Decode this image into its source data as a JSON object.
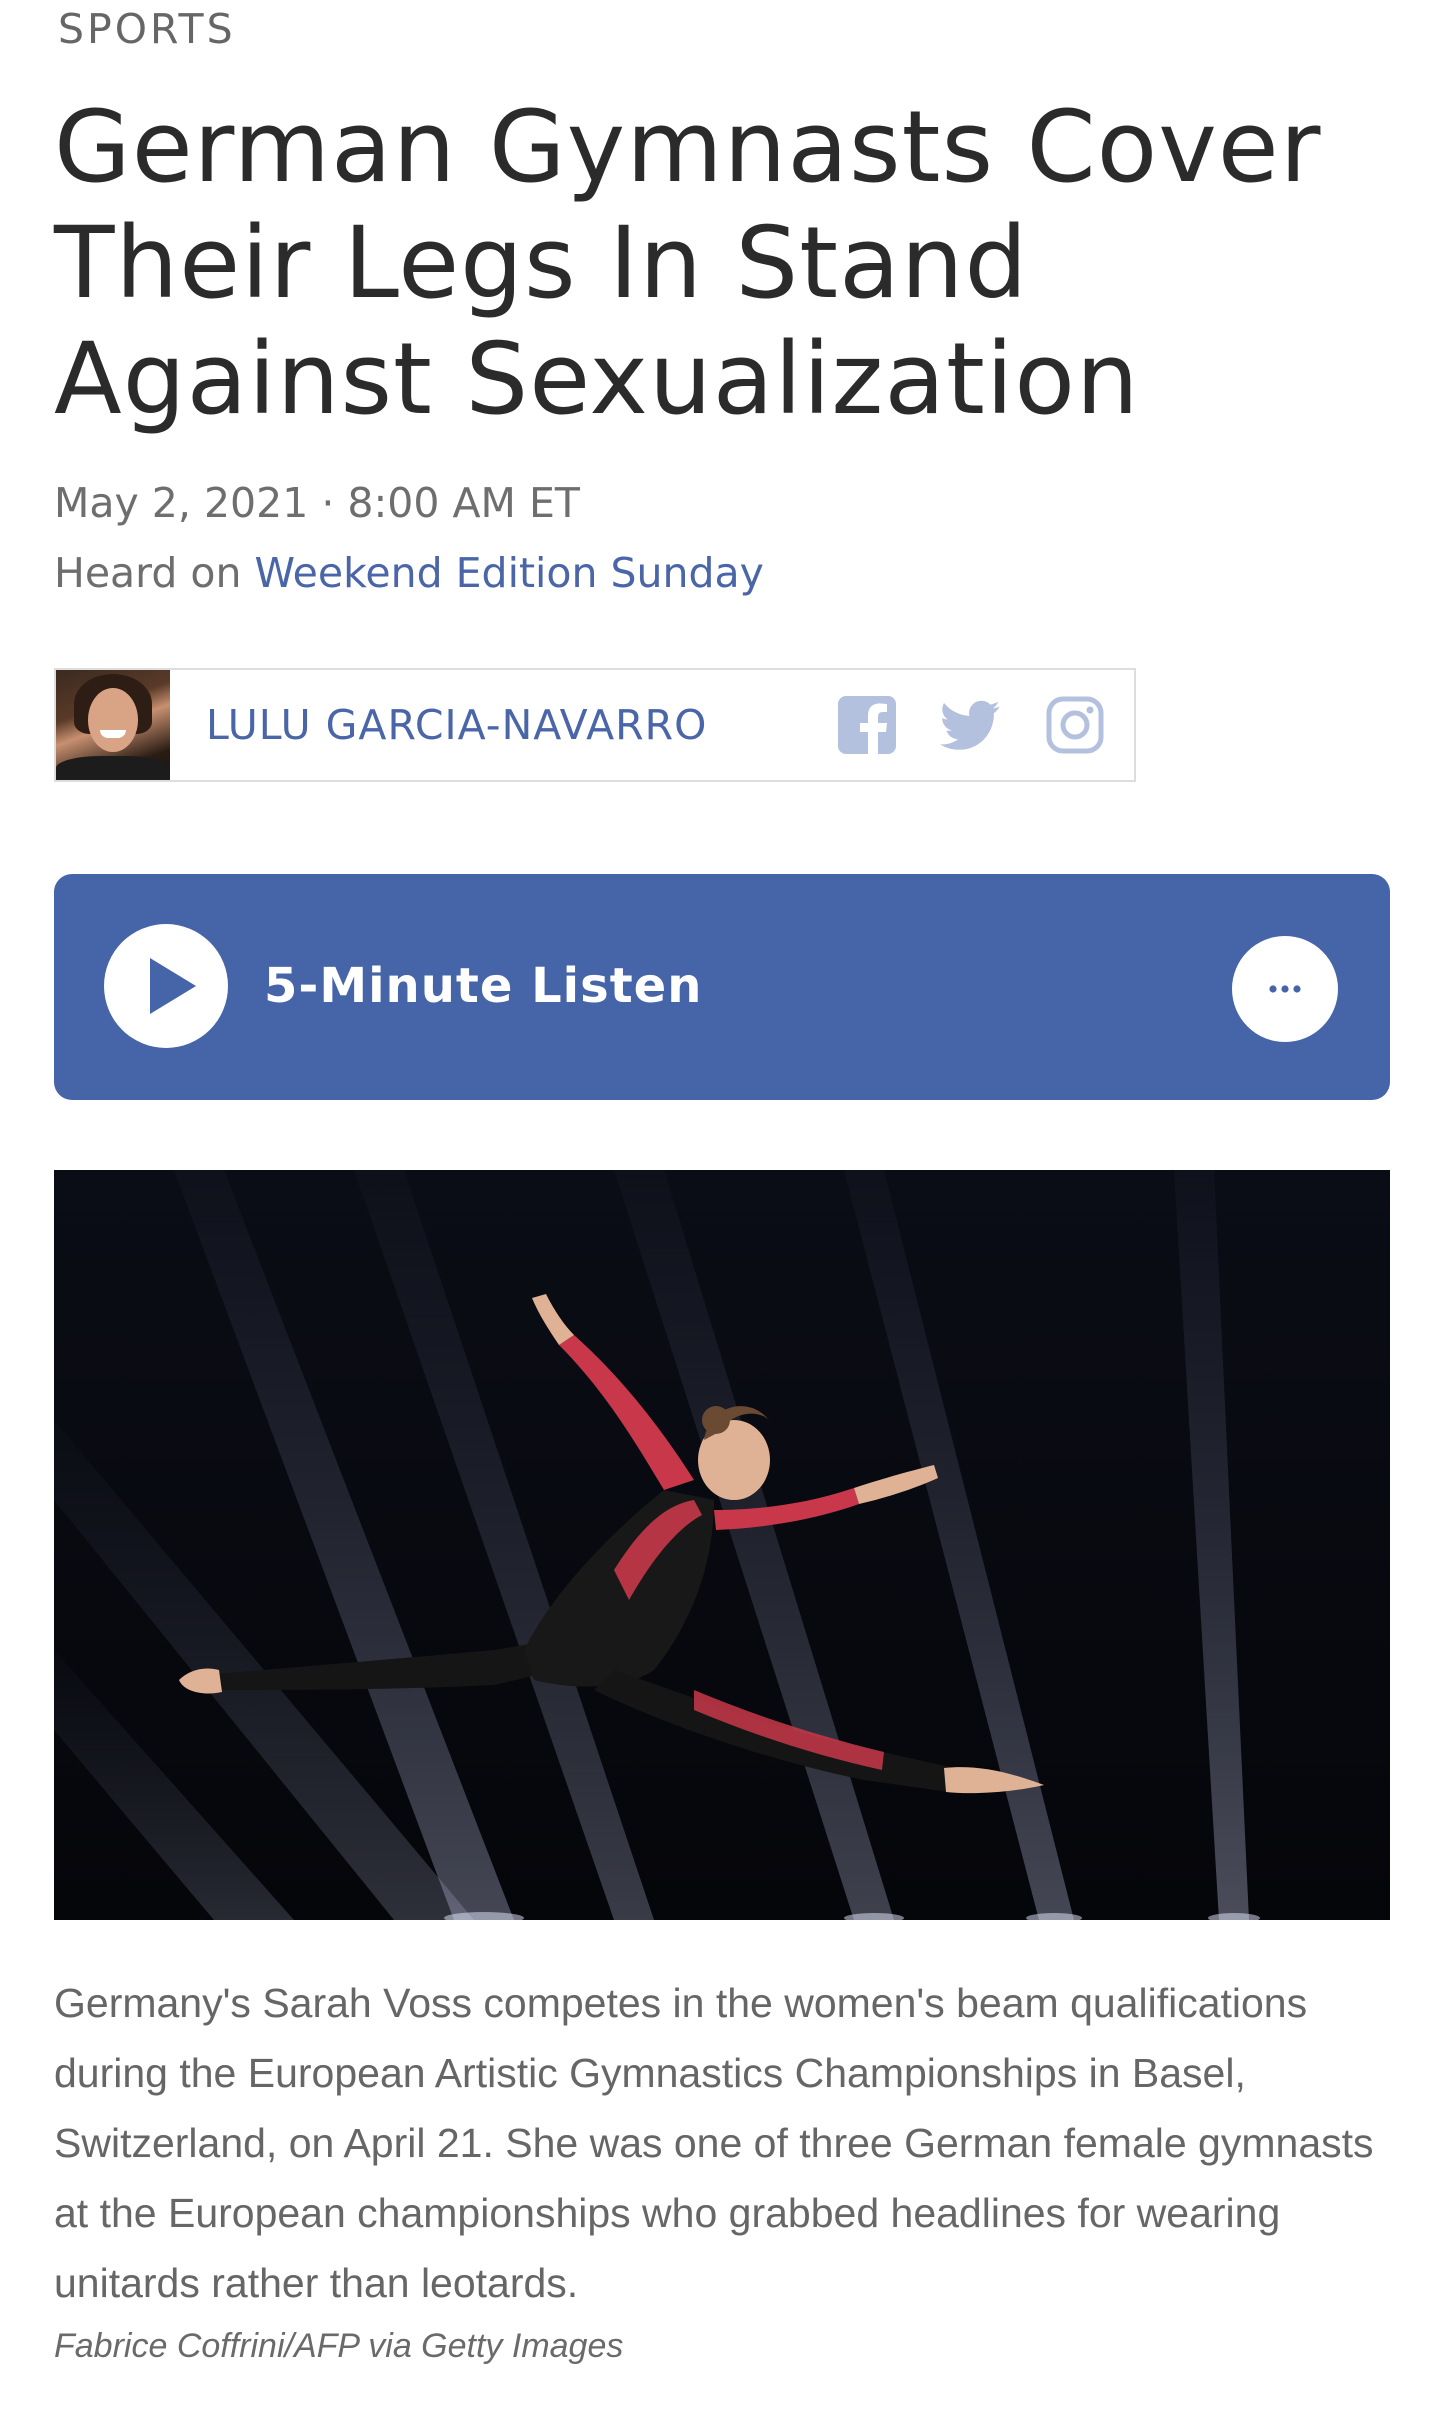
{
  "article": {
    "section": "SPORTS",
    "title": "German Gymnasts Cover Their Legs In Stand Against Sexualization",
    "date_time": "May 2, 2021 · 8:00 AM ET",
    "heard_on_prefix": "Heard on",
    "program": "Weekend Edition Sunday"
  },
  "byline": {
    "author": "LULU GARCIA-NAVARRO",
    "social": [
      "facebook-icon",
      "twitter-icon",
      "instagram-icon"
    ]
  },
  "player": {
    "label": "5-Minute Listen",
    "play_icon": "play-icon",
    "more_icon": "more-icon"
  },
  "image": {
    "caption": "Germany's Sarah Voss competes in the women's beam qualifications during the European Artistic Gymnastics Championships in Basel, Switzerland, on April 21. She was one of three German female gymnasts at the European championships who grabbed headlines for wearing unitards rather than leotards.",
    "credit": "Fabrice Coffrini/AFP via Getty Images"
  },
  "colors": {
    "accent_blue": "#4664a8",
    "link_blue": "#4a65a8",
    "icon_grey_blue": "#b3c0de",
    "text_dark": "#2b2b2b",
    "text_muted": "#6e6e6e"
  }
}
